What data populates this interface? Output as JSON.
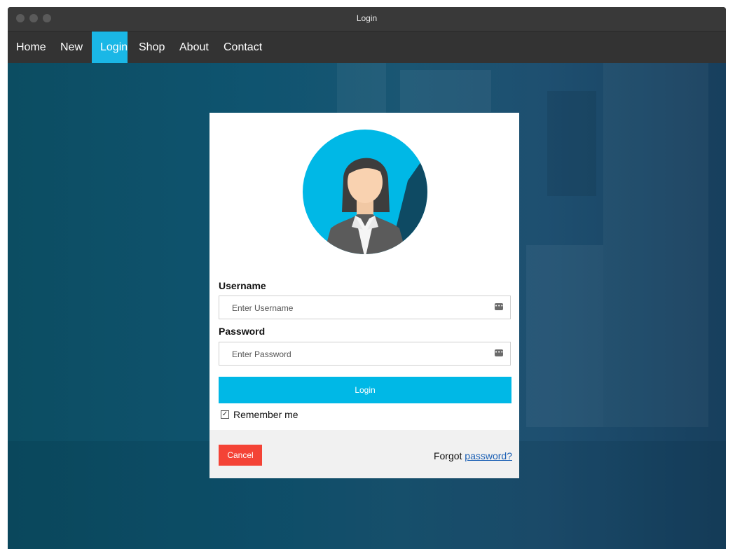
{
  "window": {
    "title": "Login"
  },
  "nav": {
    "items": [
      {
        "label": "Home"
      },
      {
        "label": "New"
      },
      {
        "label": "Login",
        "active": true
      },
      {
        "label": "Shop"
      },
      {
        "label": "About"
      },
      {
        "label": "Contact"
      }
    ]
  },
  "form": {
    "username_label": "Username",
    "username_placeholder": "Enter Username",
    "password_label": "Password",
    "password_placeholder": "Enter Password",
    "login_label": "Login",
    "remember_label": "Remember me",
    "remember_checked": true,
    "cancel_label": "Cancel",
    "forgot_prefix": "Forgot",
    "forgot_link": "password?"
  },
  "colors": {
    "accent": "#00b8e6",
    "cancel": "#f44336",
    "link": "#1a5fb4",
    "nav_bg": "#333333"
  },
  "icons": {
    "avatar": "user-avatar-female",
    "field_key": "key-icon"
  }
}
